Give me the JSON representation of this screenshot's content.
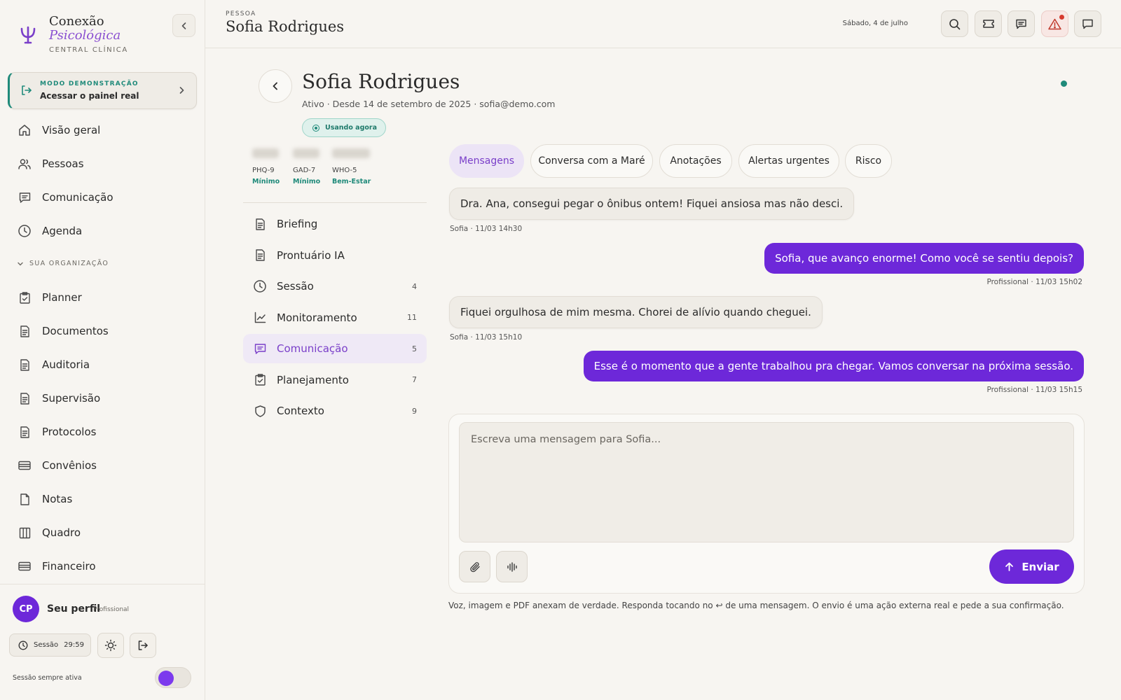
{
  "brand": {
    "name_line1": "Conexão",
    "name_line2": "Psicológica",
    "subtitle": "CENTRAL CLÍNICA"
  },
  "demo": {
    "label": "MODO DEMONSTRAÇÃO",
    "text": "Acessar o painel real",
    "accent_color": "#1f8a7a"
  },
  "nav": {
    "main": [
      {
        "label": "Visão geral",
        "icon": "home-icon"
      },
      {
        "label": "Pessoas",
        "icon": "users-icon"
      },
      {
        "label": "Comunicação",
        "icon": "chat-icon"
      },
      {
        "label": "Agenda",
        "icon": "clock-icon"
      }
    ],
    "section_label": "SUA ORGANIZAÇÃO",
    "org": [
      {
        "label": "Planner",
        "icon": "clipboard-icon"
      },
      {
        "label": "Documentos",
        "icon": "document-icon"
      },
      {
        "label": "Auditoria",
        "icon": "document-icon"
      },
      {
        "label": "Supervisão",
        "icon": "document-icon"
      },
      {
        "label": "Protocolos",
        "icon": "document-icon"
      },
      {
        "label": "Convênios",
        "icon": "card-icon"
      },
      {
        "label": "Notas",
        "icon": "file-icon"
      },
      {
        "label": "Quadro",
        "icon": "columns-icon"
      },
      {
        "label": "Financeiro",
        "icon": "card-icon"
      }
    ]
  },
  "profile": {
    "initials": "CP",
    "name": "Seu perfil",
    "role": "Profissional",
    "session_label": "Sessão",
    "session_time": "29:59",
    "always_active_label": "Sessão sempre ativa",
    "always_active_on": true
  },
  "topbar": {
    "eyebrow": "PESSOA",
    "title": "Sofia Rodrigues",
    "date": "Sábado, 4 de julho"
  },
  "person": {
    "name": "Sofia Rodrigues",
    "meta": "Ativo · Desde 14 de setembro de 2025 · sofia@demo.com",
    "status": "Usando agora",
    "scores": [
      {
        "label": "PHQ-9",
        "level": "Mínimo"
      },
      {
        "label": "GAD-7",
        "level": "Mínimo"
      },
      {
        "label": "WHO-5",
        "level": "Bem-Estar"
      }
    ],
    "sections": [
      {
        "label": "Briefing",
        "count": "",
        "icon": "document-icon"
      },
      {
        "label": "Prontuário IA",
        "count": "",
        "icon": "document-icon"
      },
      {
        "label": "Sessão",
        "count": "4",
        "icon": "clock-icon"
      },
      {
        "label": "Monitoramento",
        "count": "11",
        "icon": "chart-icon"
      },
      {
        "label": "Comunicação",
        "count": "5",
        "icon": "chat-icon",
        "active": true
      },
      {
        "label": "Planejamento",
        "count": "7",
        "icon": "clipboard-icon"
      },
      {
        "label": "Contexto",
        "count": "9",
        "icon": "shield-icon"
      }
    ]
  },
  "tabs": [
    {
      "label": "Mensagens",
      "active": true
    },
    {
      "label": "Conversa com a Maré"
    },
    {
      "label": "Anotações"
    },
    {
      "label": "Alertas urgentes"
    },
    {
      "label": "Risco"
    }
  ],
  "messages": [
    {
      "direction": "in",
      "text": "Dra. Ana, consegui pegar o ônibus ontem! Fiquei ansiosa mas não desci.",
      "meta": "Sofia · 11/03 14h30"
    },
    {
      "direction": "out",
      "text": "Sofia, que avanço enorme! Como você se sentiu depois?",
      "meta": "Profissional · 11/03 15h02"
    },
    {
      "direction": "in",
      "text": "Fiquei orgulhosa de mim mesma. Chorei de alívio quando cheguei.",
      "meta": "Sofia · 11/03 15h10"
    },
    {
      "direction": "out",
      "text": "Esse é o momento que a gente trabalhou pra chegar. Vamos conversar na próxima sessão.",
      "meta": "Profissional · 11/03 15h15"
    }
  ],
  "composer": {
    "placeholder": "Escreva uma mensagem para Sofia...",
    "value": "",
    "send_label": "Enviar",
    "hint": "Voz, imagem e PDF anexam de verdade. Responda tocando no ↩ de uma mensagem. O envio é uma ação externa real e pede a sua confirmação."
  },
  "colors": {
    "accent": "#6d28d9",
    "teal": "#1f8a7a",
    "alert": "#d63a2f"
  }
}
